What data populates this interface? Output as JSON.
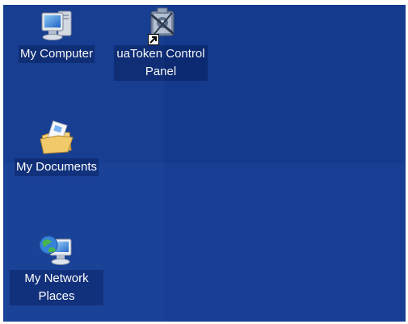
{
  "desktop": {
    "background_color": "#143d94",
    "label_background_color": "#0b2c78",
    "icons": [
      {
        "label": "My Computer",
        "icon": "my-computer-icon"
      },
      {
        "label": "uaToken Control Panel",
        "icon": "control-panel-icon",
        "shortcut": true
      },
      {
        "label": "My Documents",
        "icon": "my-documents-icon"
      },
      {
        "label": "My Network Places",
        "icon": "network-places-icon"
      }
    ]
  }
}
